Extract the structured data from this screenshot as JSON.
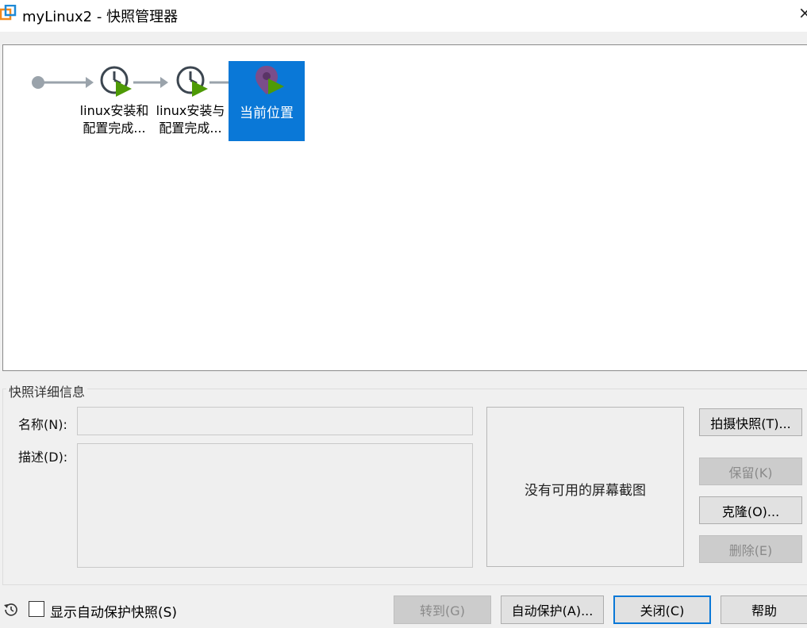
{
  "window": {
    "title": "myLinux2 - 快照管理器",
    "close_glyph": "×"
  },
  "snapshot_tree": {
    "snapshots": [
      {
        "label_line1": "linux安装和",
        "label_line2": "配置完成...",
        "icon": "snapshot-clock-icon"
      },
      {
        "label_line1": "linux安装与",
        "label_line2": "配置完成...",
        "icon": "snapshot-clock-icon"
      }
    ],
    "current": {
      "label": "当前位置",
      "icon": "location-pin-icon",
      "selected": true
    }
  },
  "details": {
    "legend": "快照详细信息",
    "name_label": "名称(N):",
    "name_value": "",
    "description_label": "描述(D):",
    "description_value": "",
    "screenshot_placeholder": "没有可用的屏幕截图"
  },
  "side_buttons": {
    "take_snapshot": "拍摄快照(T)...",
    "keep": "保留(K)",
    "clone": "克隆(O)...",
    "delete": "删除(E)"
  },
  "footer": {
    "show_autoprotect_label": "显示自动保护快照(S)",
    "show_autoprotect_checked": false,
    "goto": "转到(G)",
    "autoprotect": "自动保护(A)...",
    "close": "关闭(C)",
    "help": "帮助"
  },
  "colors": {
    "selection": "#0a78d7",
    "arrow": "#9aa3ab",
    "play_green": "#4e9a06",
    "pin_purple": "#7b4d8a"
  }
}
